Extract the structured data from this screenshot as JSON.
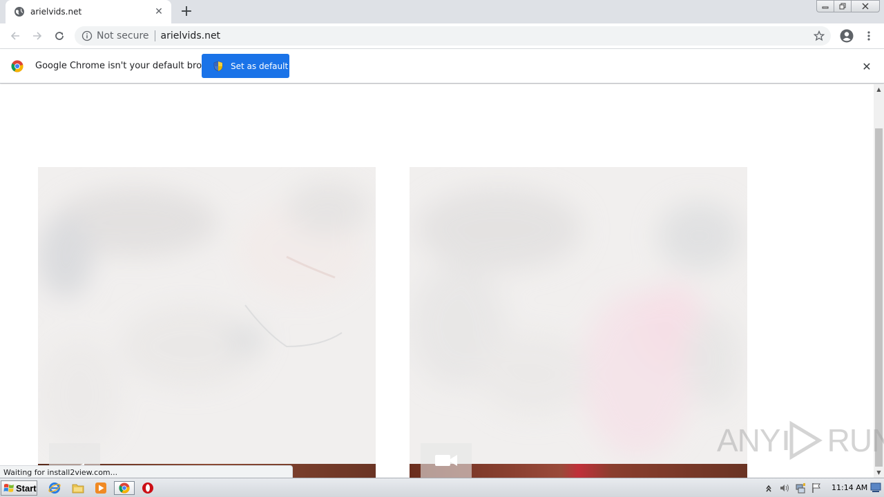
{
  "browser": {
    "tab": {
      "title": "arielvids.net"
    },
    "omnibox": {
      "security_label": "Not secure",
      "url": "arielvids.net"
    }
  },
  "infobar": {
    "message": "Google Chrome isn't your default browser",
    "button_label": "Set as default"
  },
  "content": {
    "thumbnails": [
      {
        "icon": "video-camera-icon"
      },
      {
        "icon": "video-camera-icon"
      }
    ]
  },
  "status_bubble": {
    "text": "Waiting for install2view.com..."
  },
  "watermark": {
    "text_left": "ANY",
    "text_right": "RUN"
  },
  "taskbar": {
    "start_label": "Start",
    "clock": "11:14 AM",
    "pinned": [
      "internet-explorer-icon",
      "file-explorer-icon",
      "media-player-icon",
      "chrome-icon",
      "opera-icon"
    ]
  },
  "colors": {
    "tabstrip": "#dee1e6",
    "accent_button": "#1a73e8",
    "omnibox_bg": "#f1f3f4"
  }
}
